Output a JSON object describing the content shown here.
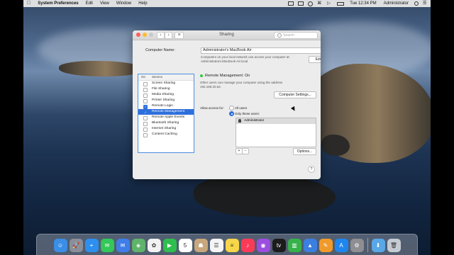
{
  "menubar": {
    "app_name": "System Preferences",
    "items": [
      "Edit",
      "View",
      "Window",
      "Help"
    ],
    "clock": "Tue 12:34 PM",
    "user": "Administrator"
  },
  "window": {
    "title": "Sharing",
    "search_placeholder": "Search",
    "computer_name_label": "Computer Name:",
    "computer_name_value": "Administrator's MacBook Air",
    "local_note_line1": "Computers on your local network can access your computer at:",
    "local_note_line2": "Administrators-MacBook-Air.local",
    "edit_button": "Edit...",
    "list_header_on": "On",
    "list_header_service": "Service",
    "services": [
      {
        "name": "Screen Sharing",
        "checked": false,
        "selected": false
      },
      {
        "name": "File Sharing",
        "checked": false,
        "selected": false
      },
      {
        "name": "Media Sharing",
        "checked": false,
        "selected": false
      },
      {
        "name": "Printer Sharing",
        "checked": false,
        "selected": false
      },
      {
        "name": "Remote Login",
        "checked": true,
        "selected": false
      },
      {
        "name": "Remote Management",
        "checked": true,
        "selected": true
      },
      {
        "name": "Remote Apple Events",
        "checked": false,
        "selected": false
      },
      {
        "name": "Bluetooth Sharing",
        "checked": false,
        "selected": false
      },
      {
        "name": "Internet Sharing",
        "checked": false,
        "selected": false
      },
      {
        "name": "Content Caching",
        "checked": false,
        "selected": false
      }
    ],
    "status_title": "Remote Management: On",
    "status_line1": "Other users can manage your computer using the address",
    "status_line2": "192.168.20.52.",
    "computer_settings_button": "Computer Settings...",
    "allow_access_label": "Allow access for:",
    "option_all": "All users",
    "option_only": "Only these users:",
    "selected_option": "only",
    "users": [
      "Administrator"
    ],
    "add_label": "+",
    "remove_label": "−",
    "options_button": "Options...",
    "help_label": "?"
  },
  "dock": {
    "apps": [
      {
        "icon": "finder-icon",
        "color": "#3a8ee6",
        "glyph": "☺"
      },
      {
        "icon": "launchpad-icon",
        "color": "#8a8f99",
        "glyph": "🚀"
      },
      {
        "icon": "safari-icon",
        "color": "#2d8ff0",
        "glyph": "⌖"
      },
      {
        "icon": "messages-icon",
        "color": "#34c759",
        "glyph": "✉"
      },
      {
        "icon": "mail-icon",
        "color": "#3f7de8",
        "glyph": "✉"
      },
      {
        "icon": "maps-icon",
        "color": "#5fb36a",
        "glyph": "◈"
      },
      {
        "icon": "photos-icon",
        "color": "#f2f2f2",
        "glyph": "✿"
      },
      {
        "icon": "facetime-icon",
        "color": "#2fbf4f",
        "glyph": "▶"
      },
      {
        "icon": "calendar-icon",
        "color": "#ffffff",
        "glyph": "5"
      },
      {
        "icon": "contacts-icon",
        "color": "#c9a77c",
        "glyph": "☗"
      },
      {
        "icon": "reminders-icon",
        "color": "#f5f5f5",
        "glyph": "☰"
      },
      {
        "icon": "notes-icon",
        "color": "#f7d64a",
        "glyph": "≡"
      },
      {
        "icon": "music-icon",
        "color": "#fa3b57",
        "glyph": "♪"
      },
      {
        "icon": "podcasts-icon",
        "color": "#9b4de0",
        "glyph": "◉"
      },
      {
        "icon": "tv-icon",
        "color": "#1c1c1c",
        "glyph": "tv"
      },
      {
        "icon": "numbers-icon",
        "color": "#36b24a",
        "glyph": "▥"
      },
      {
        "icon": "keynote-icon",
        "color": "#3b7fe0",
        "glyph": "▲"
      },
      {
        "icon": "pages-icon",
        "color": "#f09a2b",
        "glyph": "✎"
      },
      {
        "icon": "app-store-icon",
        "color": "#1e86f0",
        "glyph": "A"
      },
      {
        "icon": "system-preferences-icon",
        "color": "#8e8e93",
        "glyph": "⚙"
      },
      {
        "icon": "downloads-folder-icon",
        "color": "#5aa7e8",
        "glyph": "⬇"
      },
      {
        "icon": "trash-icon",
        "color": "#c5cbd3",
        "glyph": "🗑"
      }
    ]
  }
}
